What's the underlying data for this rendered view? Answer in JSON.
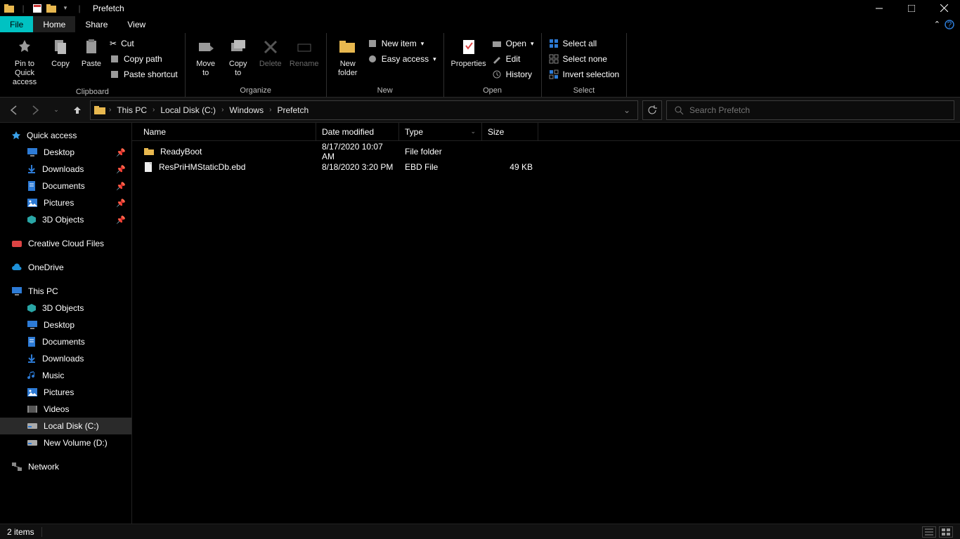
{
  "window": {
    "title": "Prefetch"
  },
  "tabs": {
    "file": "File",
    "home": "Home",
    "share": "Share",
    "view": "View"
  },
  "ribbon": {
    "pin": "Pin to Quick\naccess",
    "copy": "Copy",
    "paste": "Paste",
    "cut": "Cut",
    "copypath": "Copy path",
    "pasteshortcut": "Paste shortcut",
    "clipboard": "Clipboard",
    "moveto": "Move\nto",
    "copyto": "Copy\nto",
    "delete": "Delete",
    "rename": "Rename",
    "organize": "Organize",
    "newfolder": "New\nfolder",
    "newitem": "New item",
    "easyaccess": "Easy access",
    "new": "New",
    "properties": "Properties",
    "open": "Open",
    "edit": "Edit",
    "history": "History",
    "opengrp": "Open",
    "selectall": "Select all",
    "selectnone": "Select none",
    "invert": "Invert selection",
    "select": "Select"
  },
  "breadcrumbs": [
    "This PC",
    "Local Disk (C:)",
    "Windows",
    "Prefetch"
  ],
  "search": {
    "placeholder": "Search Prefetch"
  },
  "columns": {
    "name": "Name",
    "date": "Date modified",
    "type": "Type",
    "size": "Size"
  },
  "files": [
    {
      "icon": "folder",
      "name": "ReadyBoot",
      "date": "8/17/2020 10:07 AM",
      "type": "File folder",
      "size": ""
    },
    {
      "icon": "file",
      "name": "ResPriHMStaticDb.ebd",
      "date": "8/18/2020 3:20 PM",
      "type": "EBD File",
      "size": "49 KB"
    }
  ],
  "nav": {
    "quickaccess": "Quick access",
    "qa_items": [
      {
        "label": "Desktop",
        "icon": "desktop"
      },
      {
        "label": "Downloads",
        "icon": "download"
      },
      {
        "label": "Documents",
        "icon": "doc"
      },
      {
        "label": "Pictures",
        "icon": "pic"
      },
      {
        "label": "3D Objects",
        "icon": "cube"
      }
    ],
    "creativecloud": "Creative Cloud Files",
    "onedrive": "OneDrive",
    "thispc": "This PC",
    "pc_items": [
      {
        "label": "3D Objects",
        "icon": "cube"
      },
      {
        "label": "Desktop",
        "icon": "desktop"
      },
      {
        "label": "Documents",
        "icon": "doc"
      },
      {
        "label": "Downloads",
        "icon": "download"
      },
      {
        "label": "Music",
        "icon": "music"
      },
      {
        "label": "Pictures",
        "icon": "pic"
      },
      {
        "label": "Videos",
        "icon": "video"
      },
      {
        "label": "Local Disk (C:)",
        "icon": "disk",
        "selected": true
      },
      {
        "label": "New Volume (D:)",
        "icon": "disk"
      }
    ],
    "network": "Network"
  },
  "status": {
    "items": "2 items"
  }
}
